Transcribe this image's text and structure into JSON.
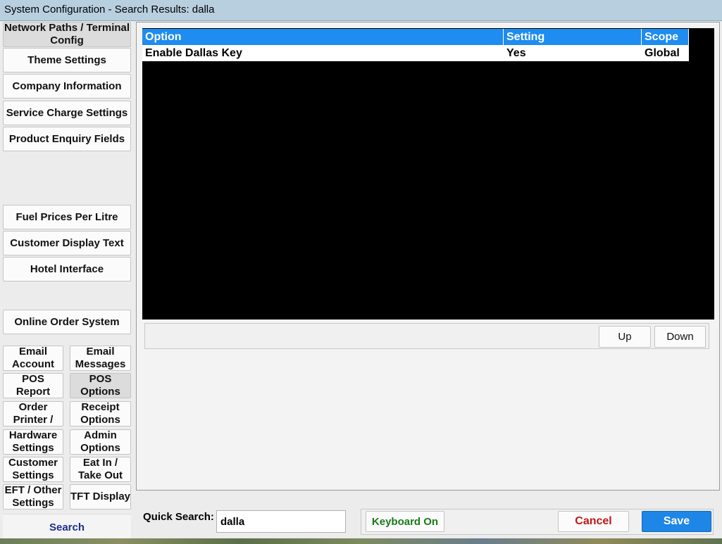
{
  "window": {
    "title": "System Configuration - Search Results: dalla"
  },
  "sidebar": {
    "items": [
      {
        "label": "Network Paths / Terminal Config"
      },
      {
        "label": "Theme Settings"
      },
      {
        "label": "Company Information"
      },
      {
        "label": "Service Charge Settings"
      },
      {
        "label": "Product Enquiry Fields"
      },
      {
        "label": "Fuel Prices Per Litre"
      },
      {
        "label": "Customer Display Text"
      },
      {
        "label": "Hotel Interface"
      },
      {
        "label": "Online Order System"
      }
    ],
    "pairs": [
      {
        "left": "Email Account",
        "right": "Email Messages"
      },
      {
        "left": "POS Report",
        "right": "POS Options"
      },
      {
        "left": "Order Printer /",
        "right": "Receipt Options"
      },
      {
        "left": "Hardware Settings",
        "right": "Admin Options"
      },
      {
        "left": "Customer Settings",
        "right": "Eat In / Take Out"
      },
      {
        "left": "EFT / Other Settings",
        "right": "TFT Display"
      }
    ],
    "search_label": "Search"
  },
  "grid": {
    "columns": [
      "Option",
      "Setting",
      "Scope"
    ],
    "rows": [
      [
        "Enable Dallas Key",
        "Yes",
        "Global"
      ]
    ]
  },
  "nav": {
    "up_label": "Up",
    "down_label": "Down"
  },
  "footer": {
    "quick_search_label": "Quick Search:",
    "quick_search_value": "dalla",
    "keyboard_label": "Keyboard On",
    "cancel_label": "Cancel",
    "save_label": "Save"
  },
  "colors": {
    "header_blue": "#1e8cf0",
    "save_blue": "#1e86e6",
    "cancel_red": "#c01818",
    "keyboard_green": "#1a7a1a",
    "search_navy": "#1d2e8f"
  }
}
